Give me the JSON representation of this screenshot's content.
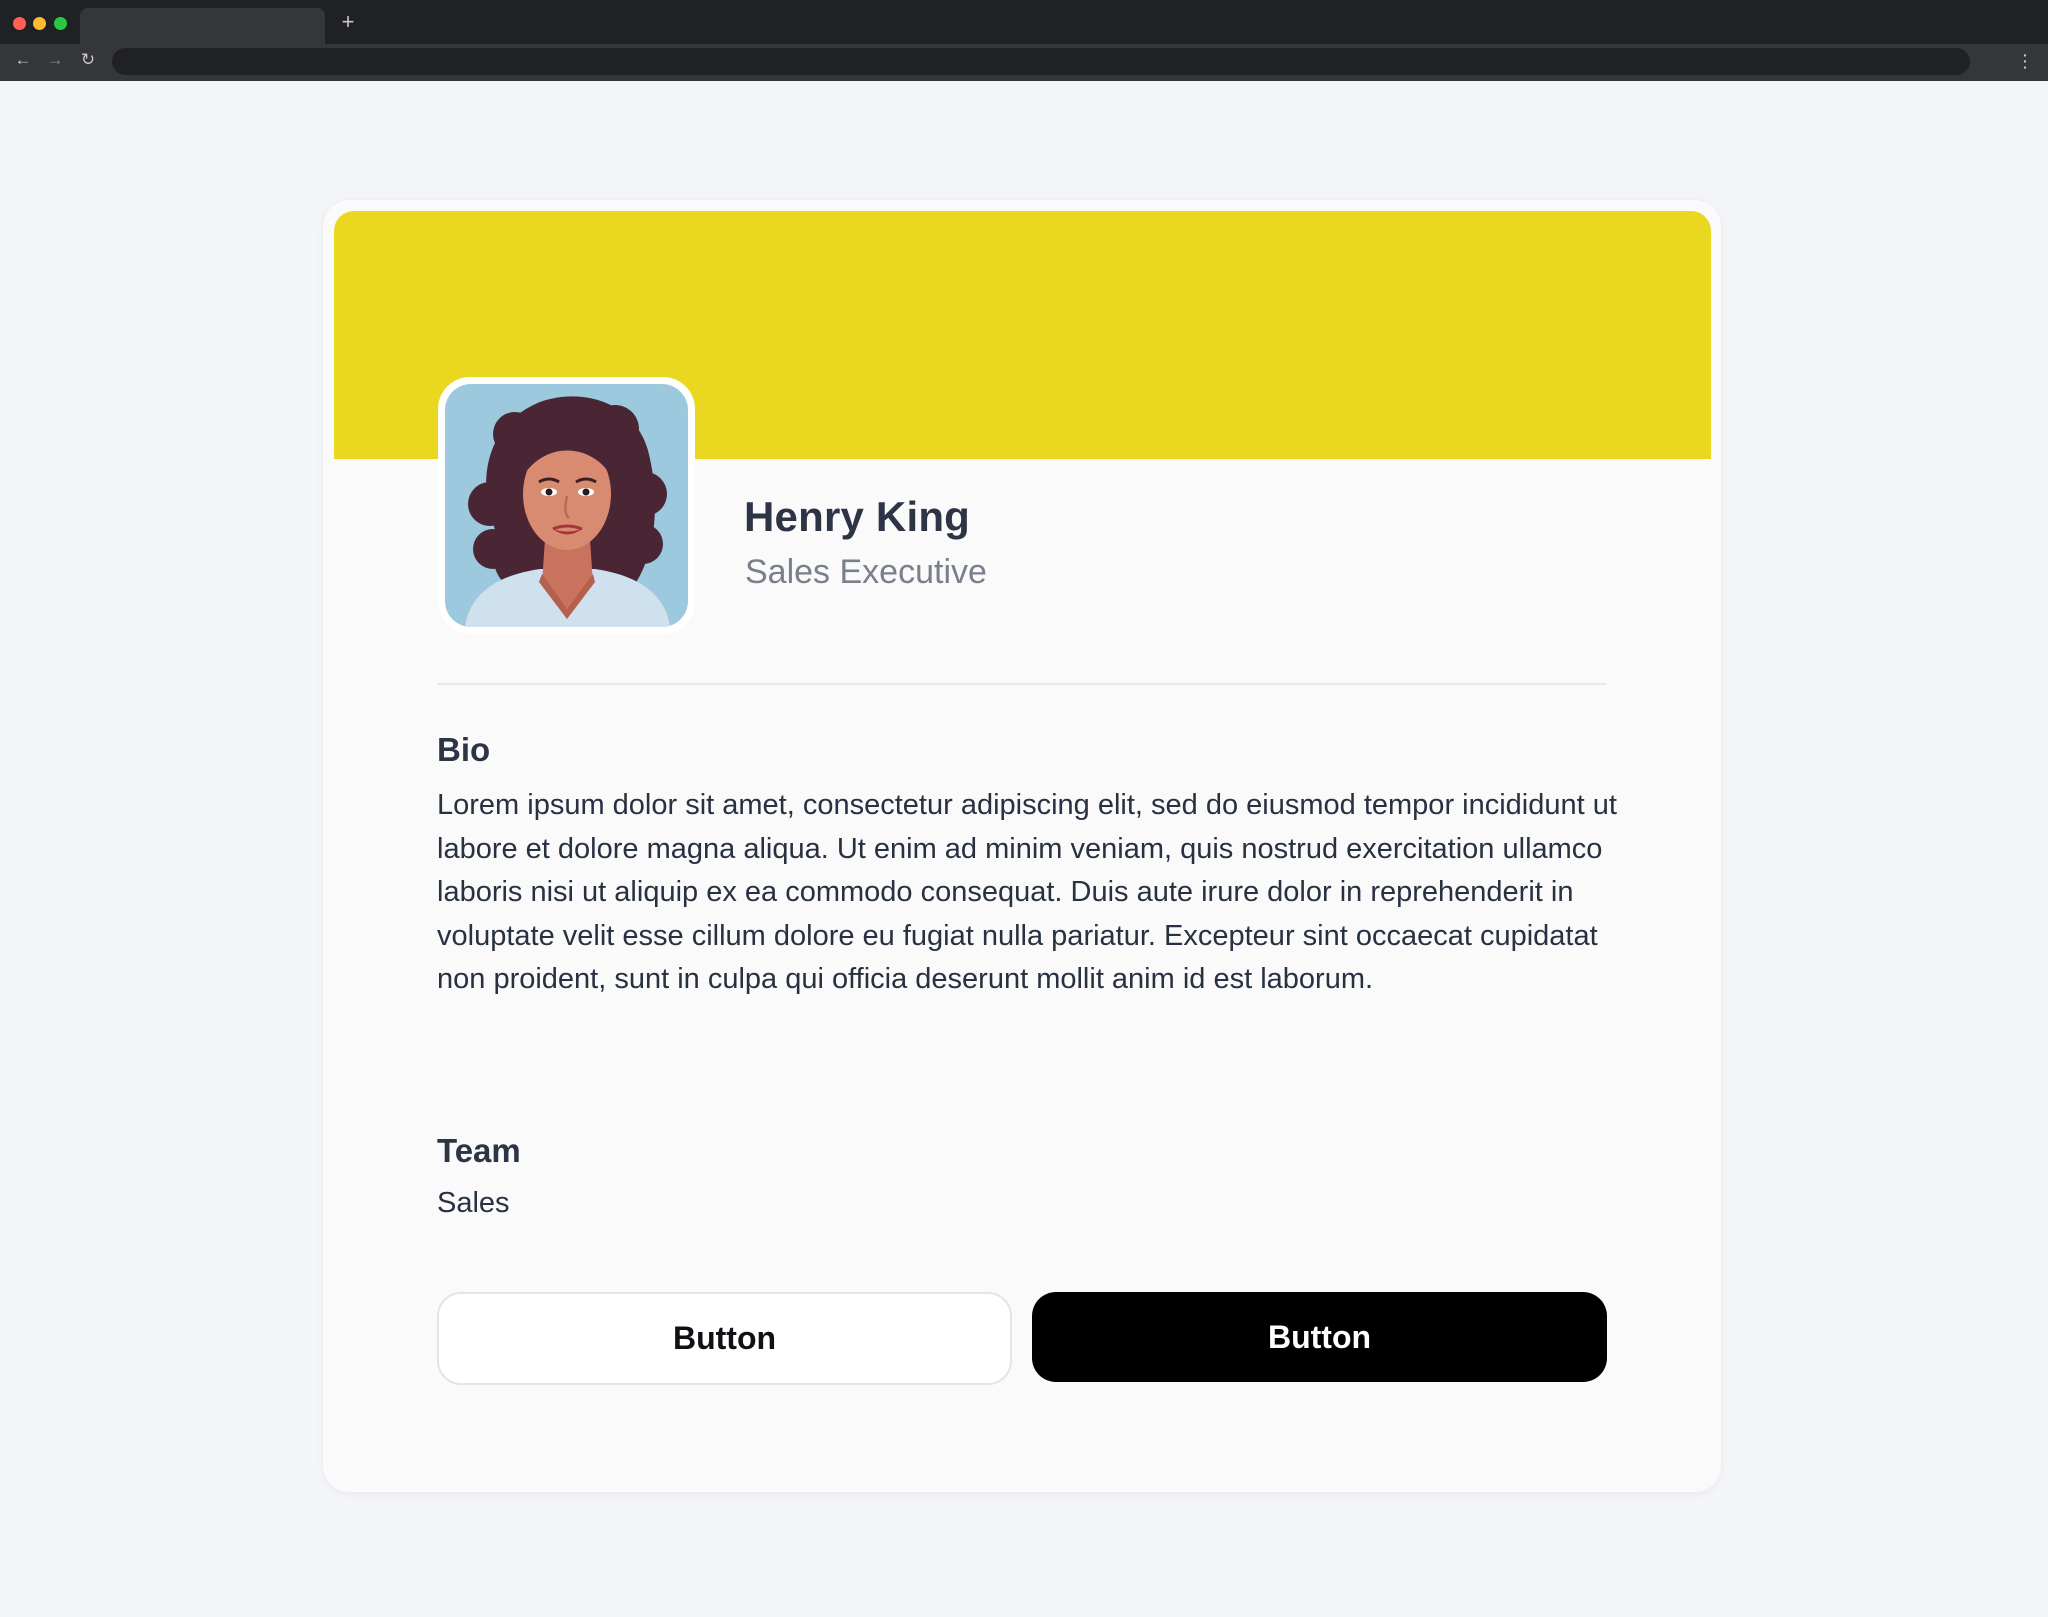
{
  "browser": {
    "new_tab_glyph": "+",
    "back_icon": "←",
    "forward_icon": "→",
    "reload_icon": "↻",
    "menu_icon": "⋮"
  },
  "profile": {
    "name": "Henry King",
    "role": "Sales Executive",
    "banner_color": "#e9d81f"
  },
  "bio": {
    "title": "Bio",
    "text": "Lorem ipsum dolor sit amet, consectetur adipiscing elit, sed do eiusmod tempor incididunt ut labore et dolore magna aliqua. Ut enim ad minim veniam, quis nostrud exercitation ullamco laboris nisi ut aliquip ex ea commodo consequat. Duis aute irure dolor in reprehenderit in voluptate velit esse cillum dolore eu fugiat nulla pariatur. Excepteur sint occaecat cupidatat non proident, sunt in culpa qui officia deserunt mollit anim id est laborum."
  },
  "team": {
    "title": "Team",
    "value": "Sales"
  },
  "actions": {
    "secondary_label": "Button",
    "primary_label": "Button"
  }
}
